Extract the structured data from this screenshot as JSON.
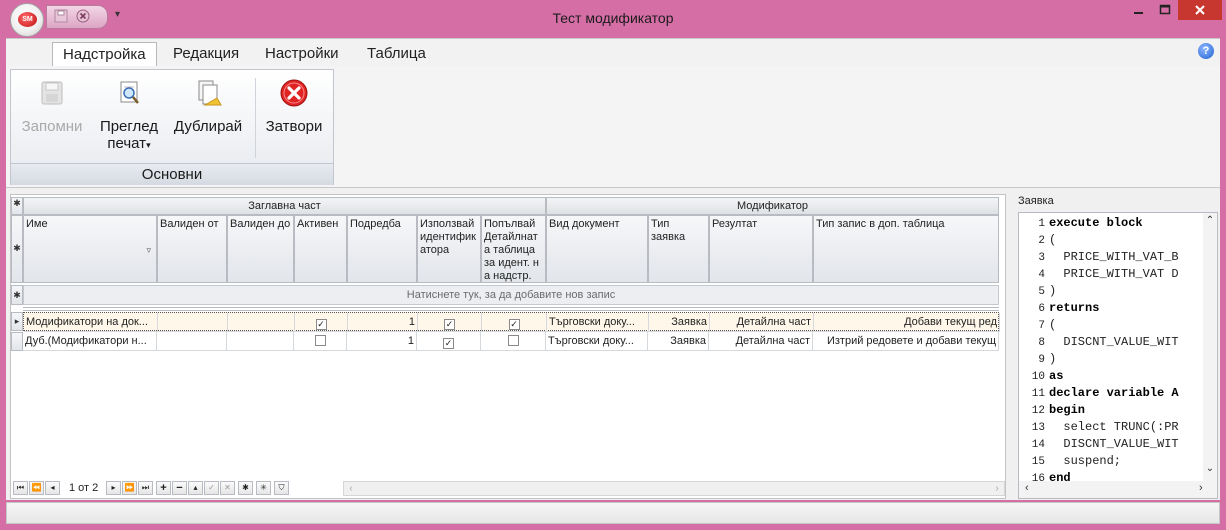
{
  "window": {
    "title": "Тест модификатор",
    "logo_text": "SM",
    "qat_arrow": "▾"
  },
  "ribbon": {
    "tabs": [
      {
        "label": "Надстройка",
        "active": true
      },
      {
        "label": "Редакция",
        "active": false
      },
      {
        "label": "Настройки",
        "active": false
      },
      {
        "label": "Таблица",
        "active": false
      }
    ],
    "help_label": "?",
    "group_caption": "Основни",
    "buttons": {
      "save": "Запомни",
      "preview_line1": "Преглед",
      "preview_line2": "печат",
      "preview_arrow": "▾",
      "duplicate": "Дублирай",
      "close": "Затвори"
    }
  },
  "grid": {
    "bands": {
      "main": "Заглавна част",
      "modifier": "Модификатор"
    },
    "columns": {
      "name": "Име",
      "valid_from": "Валиден от",
      "valid_to": "Валиден до",
      "active": "Активен",
      "order": "Подредба",
      "use_ident": "Използвай идентификатора",
      "fill_detail": "Попълвай Детайлната таблица за идент. на надстр.",
      "doc_type": "Вид документ",
      "request_type": "Тип заявка",
      "result": "Резултат",
      "record_type": "Тип запис в доп. таблица"
    },
    "new_row_text": "Натиснете тук, за да добавите нов запис",
    "rows": [
      {
        "name": "Модификатори на док...",
        "valid_from": "",
        "valid_to": "",
        "active": true,
        "order": "1",
        "use_ident": true,
        "fill_detail": true,
        "doc_type": "Търговски доку...",
        "request_type": "Заявка",
        "result": "Детайлна част",
        "record_type": "Добави текущ ред"
      },
      {
        "name": "Дуб.(Модификатори н...",
        "valid_from": "",
        "valid_to": "",
        "active": false,
        "order": "1",
        "use_ident": true,
        "fill_detail": false,
        "doc_type": "Търговски доку...",
        "request_type": "Заявка",
        "result": "Детайлна част",
        "record_type": "Изтрий редовете и добави текущ"
      }
    ],
    "navigator": {
      "record_counter": "1 от 2"
    }
  },
  "sql": {
    "label": "Заявка",
    "lines": [
      {
        "n": "1",
        "text": "execute block"
      },
      {
        "n": "2",
        "text": "("
      },
      {
        "n": "3",
        "text": "  PRICE_WITH_VAT_B"
      },
      {
        "n": "4",
        "text": "  PRICE_WITH_VAT D"
      },
      {
        "n": "5",
        "text": ")"
      },
      {
        "n": "6",
        "text": "returns"
      },
      {
        "n": "7",
        "text": "("
      },
      {
        "n": "8",
        "text": "  DISCNT_VALUE_WIT"
      },
      {
        "n": "9",
        "text": ")"
      },
      {
        "n": "10",
        "text": "as"
      },
      {
        "n": "11",
        "text": "declare variable A"
      },
      {
        "n": "12",
        "text": "begin"
      },
      {
        "n": "13",
        "text": "  select TRUNC(:PR"
      },
      {
        "n": "14",
        "text": "  DISCNT_VALUE_WIT"
      },
      {
        "n": "15",
        "text": "  suspend;"
      },
      {
        "n": "16",
        "text": "end"
      }
    ]
  },
  "colors": {
    "window_frame": "#d66ea6",
    "close_button": "#c7372f",
    "ribbon_bg": "#f4f4f4"
  }
}
